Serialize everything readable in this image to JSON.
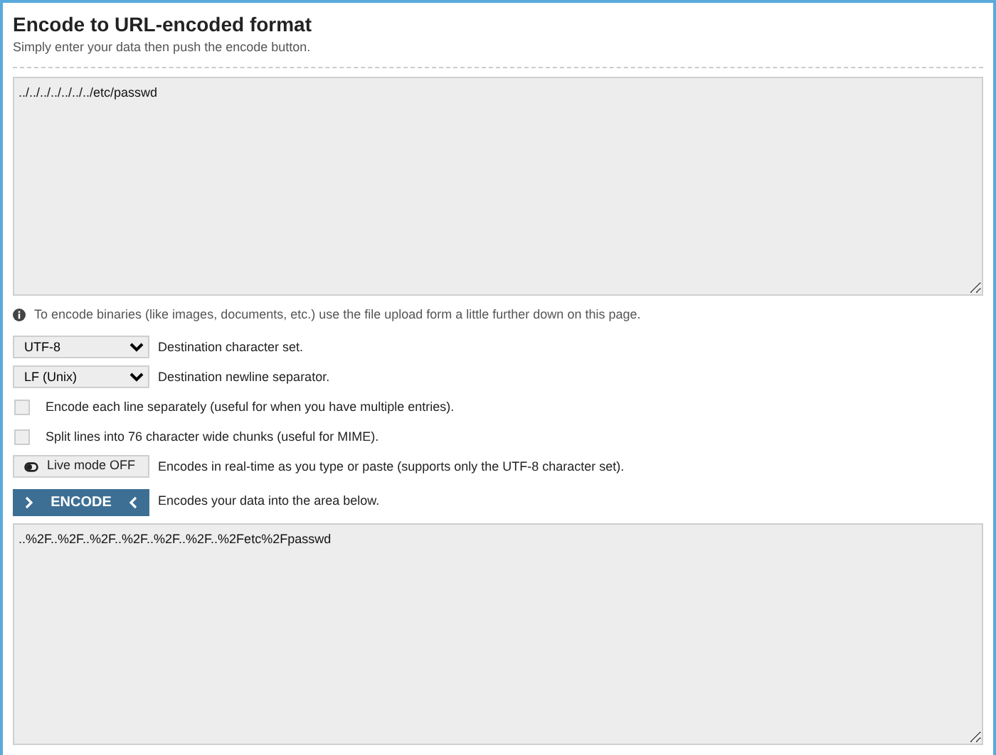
{
  "title": "Encode to URL-encoded format",
  "subtitle": "Simply enter your data then push the encode button.",
  "input": {
    "value": "../../../../../../../etc/passwd"
  },
  "info": "To encode binaries (like images, documents, etc.) use the file upload form a little further down on this page.",
  "options": [
    {
      "kind": "select",
      "value": "UTF-8",
      "description": "Destination character set."
    },
    {
      "kind": "select",
      "value": "LF (Unix)",
      "description": "Destination newline separator."
    },
    {
      "kind": "checkbox",
      "checked": false,
      "description": "Encode each line separately (useful for when you have multiple entries)."
    },
    {
      "kind": "checkbox",
      "checked": false,
      "description": "Split lines into 76 character wide chunks (useful for MIME)."
    },
    {
      "kind": "toggle",
      "on": false,
      "button": "Live mode OFF",
      "description": "Encodes in real-time as you type or paste (supports only the UTF-8 character set)."
    },
    {
      "kind": "action",
      "button": "ENCODE",
      "description": "Encodes your data into the area below."
    }
  ],
  "output": {
    "value": "..%2F..%2F..%2F..%2F..%2F..%2F..%2Fetc%2Fpasswd"
  }
}
